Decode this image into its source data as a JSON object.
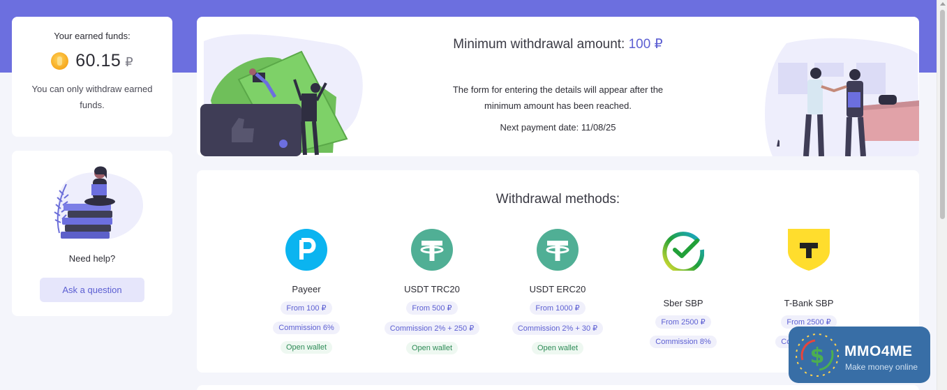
{
  "sidebar": {
    "funds": {
      "title": "Your earned funds:",
      "amount": "60.15",
      "currency": "₽",
      "note": "You can only withdraw earned funds."
    },
    "help": {
      "title": "Need help?",
      "button_label": "Ask a question"
    }
  },
  "minimum": {
    "title_prefix": "Minimum withdrawal amount:",
    "amount": "100 ₽",
    "description": "The form for entering the details will appear after the minimum amount has been reached.",
    "next_payment": "Next payment date: 11/08/25"
  },
  "methods": {
    "title": "Withdrawal methods:",
    "items": [
      {
        "name": "Payeer",
        "icon": "payeer-icon",
        "from": "From 100 ₽",
        "commission": "Commission 6%",
        "wallet": "Open wallet"
      },
      {
        "name": "USDT TRC20",
        "icon": "tether-icon",
        "from": "From 500 ₽",
        "commission": "Commission 2% + 250 ₽",
        "wallet": "Open wallet"
      },
      {
        "name": "USDT ERC20",
        "icon": "tether-icon",
        "from": "From 1000 ₽",
        "commission": "Commission 2% + 30 ₽",
        "wallet": "Open wallet"
      },
      {
        "name": "Sber SBP",
        "icon": "sber-icon",
        "from": "From 2500 ₽",
        "commission": "Commission 8%"
      },
      {
        "name": "T-Bank SBP",
        "icon": "tbank-icon",
        "from": "From 2500 ₽",
        "commission": "Commission 8%"
      }
    ]
  },
  "watermark": {
    "title": "MMO4ME",
    "subtitle": "Make money online"
  },
  "colors": {
    "accent": "#6c6fdf",
    "link": "#5c5fd2",
    "payeer": "#0bb4f0",
    "tether": "#50af95",
    "tbank": "#ffdd2d"
  }
}
